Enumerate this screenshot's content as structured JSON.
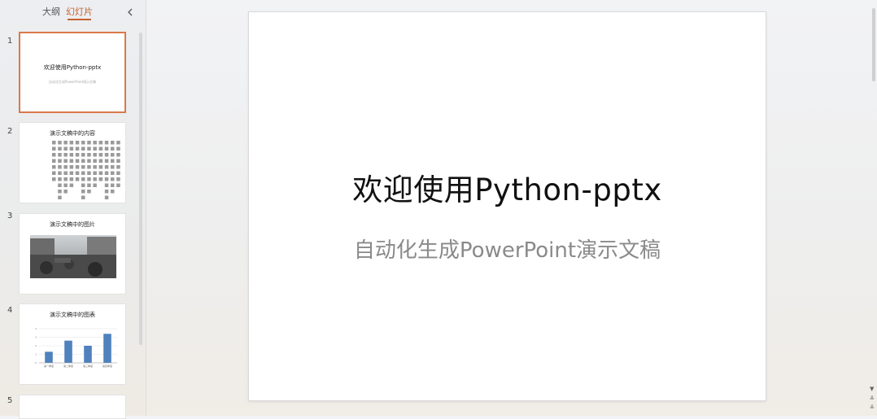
{
  "sidebar": {
    "tabs": {
      "outline": "大纲",
      "slides": "幻灯片"
    },
    "thumbnails": [
      {
        "num": "1",
        "title": "欢迎使用Python-pptx",
        "subtitle": "自动化生成PowerPoint演示文稿"
      },
      {
        "num": "2",
        "title": "演示文稿中的内容"
      },
      {
        "num": "3",
        "title": "演示文稿中的图片"
      },
      {
        "num": "4",
        "title": "演示文稿中的图表",
        "chart_data": {
          "type": "bar",
          "categories": [
            "第一季度",
            "第二季度",
            "第三季度",
            "第四季度"
          ],
          "values": [
            1.3,
            2.6,
            2.0,
            3.4
          ]
        }
      },
      {
        "num": "5"
      }
    ]
  },
  "slide": {
    "title": "欢迎使用Python-pptx",
    "subtitle": "自动化生成PowerPoint演示文稿"
  },
  "colors": {
    "accent": "#c5612f",
    "bar": "#4f81bd"
  }
}
